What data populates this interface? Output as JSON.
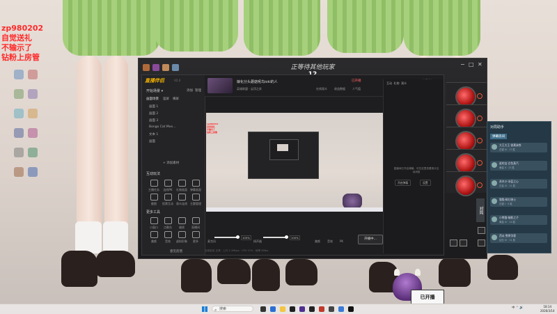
{
  "overlay": {
    "lines": [
      "zp980202",
      "自觉送礼",
      "不输示了",
      "钻粉上房管"
    ]
  },
  "lobby": {
    "title": "正等待其他玩家",
    "count": "12",
    "controls": [
      "−",
      "□",
      "✕"
    ]
  },
  "app": {
    "logo": "直播伴侣",
    "version": "V2.4",
    "sidebar": {
      "section_scene": "开始场景 ▾",
      "scene_actions": [
        "添加",
        "管理"
      ],
      "scene_tabs": [
        "画面场景",
        "竖屏",
        "横屏"
      ],
      "sources": [
        "画面 1",
        "画面 2",
        "画面 3",
        "Bongo Cat Mve...",
        "文本 1",
        "画面"
      ],
      "add_source": "+ 添加素材",
      "section_tools": "互动玩法",
      "tools_row1": [
        "主播任务",
        "连线PK",
        "礼物画面",
        "弹幕画面"
      ],
      "tools_row2": [
        "截图",
        "投票互动",
        "观众连线",
        "主题管理"
      ],
      "section_more": "更多工具",
      "tools_row3": [
        "小窗口",
        "点歌台",
        "福袋",
        "直播间"
      ],
      "tools_row4": [
        "美颜",
        "音效",
        "虚拟形象",
        "更多"
      ],
      "footer_link": "意见反馈"
    },
    "header": {
      "stream_title": "娘化分头蘑菇呢鸟loki的人",
      "category": "英雄联盟 · 云顶之弈",
      "live_badge": "已开播",
      "stats": [
        "在线观众",
        "收益数据",
        "人气值"
      ],
      "status": "主播状态"
    },
    "chat": {
      "tabs": [
        "互动",
        "礼物",
        "观众"
      ],
      "message": "直播间已开启弹幕，可在这里查看观众互动消息",
      "buttons": [
        "开启弹幕",
        "设置"
      ]
    },
    "bottom": {
      "mic_label": "麦克风",
      "mic_value": "100%",
      "speaker_label": "扬声器",
      "speaker_value": "100%",
      "icons": [
        "美颜",
        "音效",
        "PK"
      ],
      "start_label": "开播中..."
    },
    "footer": "当前延迟 正常  ·  上行 2.1Mbps  ·  CPU 21%  ·  帧率 60fps"
  },
  "side_panel": {
    "title": "对局助手",
    "tab": "弹幕房间",
    "rows": [
      {
        "name": "大王大王·香蕉拿铁",
        "sub": "白银 III · 17 胜"
      },
      {
        "name": "谁的宝·白色蒸汽",
        "sub": "黄金 II · 23 胜"
      },
      {
        "name": "苏木沙·冰蓝之心",
        "sub": "白金 IV · 11 胜"
      },
      {
        "name": "猫猫·绯红骑士",
        "sub": "白银 I · 9 胜"
      },
      {
        "name": "小熊猫·暗影之子",
        "sub": "黄金 IV · 14 胜"
      },
      {
        "name": "西瓜·雪原剑客",
        "sub": "钻石 IV · 31 胜"
      }
    ],
    "vertical_label": "对局"
  },
  "mascot": {
    "card_text": "已开播"
  },
  "taskbar": {
    "search_placeholder": "搜索",
    "tray": "中  ⌃  🔊",
    "time": "18:14",
    "date": "2026/3/14"
  },
  "colors": {
    "overlay_red": "#ff2a2a",
    "accent_gold": "#f0b000",
    "live_red": "#ff6060",
    "side_panel_bg": "#243845"
  }
}
